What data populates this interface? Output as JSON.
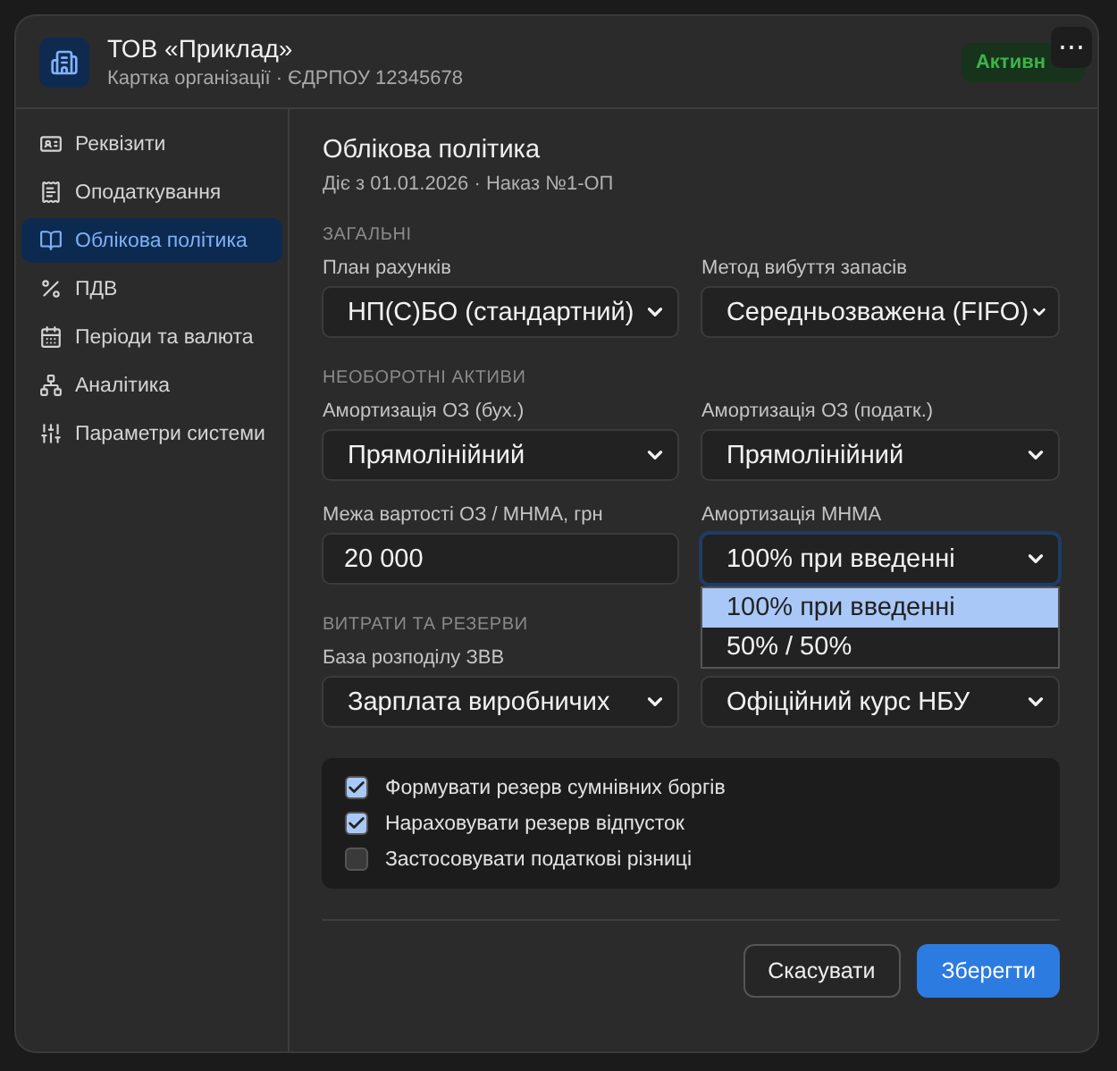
{
  "header": {
    "title": "ТОВ «Приклад»",
    "subtitle": "Картка організації · ЄДРПОУ 12345678",
    "status": "Активн",
    "more_button": "⋯"
  },
  "sidebar": {
    "items": [
      {
        "label": "Реквізити",
        "selected": false
      },
      {
        "label": "Оподаткування",
        "selected": false
      },
      {
        "label": "Облікова політика",
        "selected": true
      },
      {
        "label": "ПДВ",
        "selected": false
      },
      {
        "label": "Періоди та валюта",
        "selected": false
      },
      {
        "label": "Аналітика",
        "selected": false
      },
      {
        "label": "Параметри системи",
        "selected": false
      }
    ]
  },
  "content": {
    "title": "Облікова політика",
    "subtitle": "Діє з 01.01.2026 · Наказ №1-ОП",
    "sections": [
      {
        "heading": "ЗАГАЛЬНІ",
        "fields": [
          {
            "kind": "select",
            "label": "План рахунків",
            "value": "НП(С)БО (стандартний)"
          },
          {
            "kind": "select",
            "label": "Метод вибуття запасів",
            "value": "Середньозважена (FIFO)"
          }
        ]
      },
      {
        "heading": "НЕОБОРОТНІ АКТИВИ",
        "fields": [
          {
            "kind": "select",
            "label": "Амортизація ОЗ (бух.)",
            "value": "Прямолінійний"
          },
          {
            "kind": "select",
            "label": "Амортизація ОЗ (податк.)",
            "value": "Прямолінійний"
          },
          {
            "kind": "input",
            "label": "Межа вартості ОЗ / МНМА, грн",
            "value": "20 000"
          },
          {
            "kind": "select",
            "label": "Амортизація МНМА",
            "value": "100% при введенні",
            "expanded": true,
            "options": [
              {
                "label": "100% при введенні",
                "selected": true
              },
              {
                "label": "50% / 50%",
                "selected": false
              }
            ]
          }
        ]
      },
      {
        "heading": "ВИТРАТИ ТА РЕЗЕРВИ",
        "fields": [
          {
            "kind": "select",
            "label": "База розподілу ЗВВ",
            "value": "Зарплата виробничих"
          },
          {
            "kind": "select",
            "value": "Офіційний курс НБУ"
          }
        ]
      }
    ],
    "checkboxes": [
      {
        "label": "Формувати резерв сумнівних боргів",
        "checked": true
      },
      {
        "label": "Нараховувати резерв відпусток",
        "checked": true
      },
      {
        "label": "Застосовувати податкові різниці",
        "checked": false
      }
    ]
  },
  "buttons": [
    {
      "label": "Скасувати",
      "kind": "secondary"
    },
    {
      "label": "Зберегти",
      "kind": "primary"
    }
  ]
}
